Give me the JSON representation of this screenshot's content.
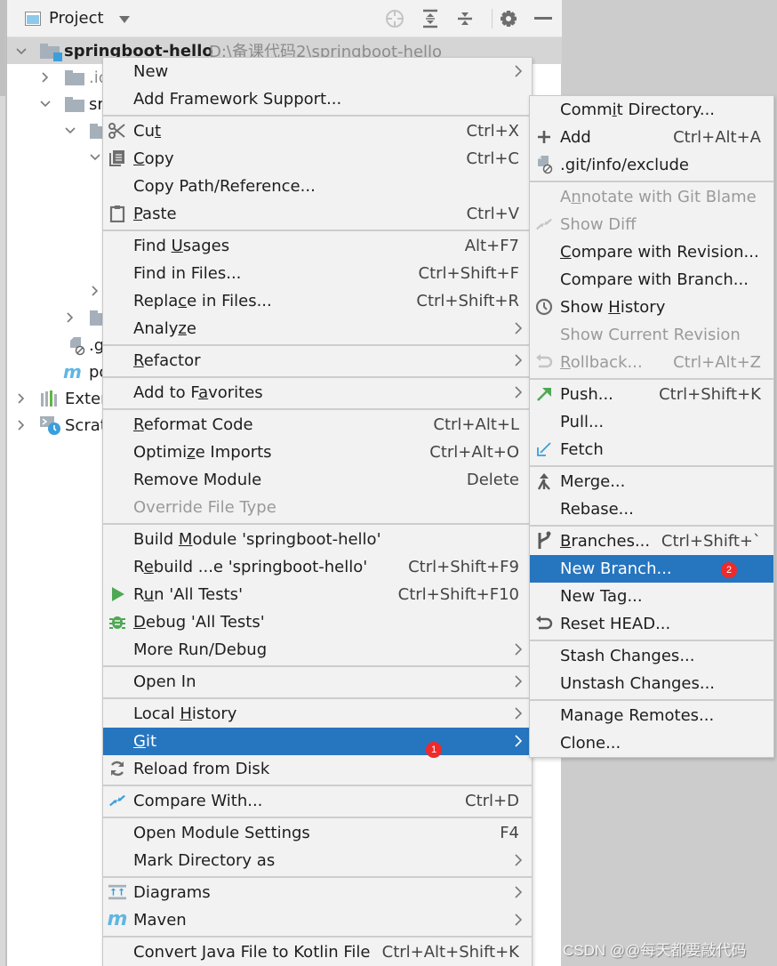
{
  "project_panel": {
    "title": "Project",
    "toolbar": [
      "locate-icon",
      "expand-all-icon",
      "collapse-all-icon",
      "gear-icon",
      "minimize-icon"
    ],
    "tree": [
      {
        "label": "springboot-hello",
        "path": "D:\\备课代码2\\springboot-hello",
        "expanded": true,
        "selected": true
      },
      {
        "label": ".idea",
        "visible": ".ic",
        "expanded": false
      },
      {
        "label": "src",
        "visible": "sr",
        "expanded": true
      },
      {
        "label": "",
        "expanded": true
      },
      {
        "label": "",
        "expanded": true
      },
      {
        "label": "",
        "expanded": false
      },
      {
        "label": "",
        "expanded": false
      },
      {
        "label": ".gitignore",
        "visible": ".g"
      },
      {
        "label": "pom.xml",
        "visible": "pc"
      },
      {
        "label": "External Libraries",
        "visible": "Exter",
        "expanded": false
      },
      {
        "label": "Scratches and Consoles",
        "visible": "Scrat",
        "expanded": false
      }
    ]
  },
  "context_menu": {
    "items": [
      {
        "label": "New",
        "submenu": true
      },
      {
        "label": "Add Framework Support..."
      },
      {
        "separator": true
      },
      {
        "label": "Cut",
        "shortcut": "Ctrl+X",
        "icon": "scissors-icon"
      },
      {
        "label": "Copy",
        "shortcut": "Ctrl+C",
        "icon": "copy-icon"
      },
      {
        "label": "Copy Path/Reference..."
      },
      {
        "label": "Paste",
        "shortcut": "Ctrl+V",
        "icon": "clipboard-icon"
      },
      {
        "separator": true
      },
      {
        "label": "Find Usages",
        "shortcut": "Alt+F7"
      },
      {
        "label": "Find in Files...",
        "shortcut": "Ctrl+Shift+F"
      },
      {
        "label": "Replace in Files...",
        "shortcut": "Ctrl+Shift+R"
      },
      {
        "label": "Analyze",
        "submenu": true
      },
      {
        "separator": true
      },
      {
        "label": "Refactor",
        "submenu": true
      },
      {
        "separator": true
      },
      {
        "label": "Add to Favorites",
        "submenu": true
      },
      {
        "separator": true
      },
      {
        "label": "Reformat Code",
        "shortcut": "Ctrl+Alt+L"
      },
      {
        "label": "Optimize Imports",
        "shortcut": "Ctrl+Alt+O"
      },
      {
        "label": "Remove Module",
        "shortcut": "Delete"
      },
      {
        "label": "Override File Type",
        "disabled": true
      },
      {
        "separator": true
      },
      {
        "label": "Build Module 'springboot-hello'"
      },
      {
        "label": "Rebuild ...e 'springboot-hello'",
        "shortcut": "Ctrl+Shift+F9"
      },
      {
        "label": "Run 'All Tests'",
        "shortcut": "Ctrl+Shift+F10",
        "icon": "run-icon"
      },
      {
        "label": "Debug 'All Tests'",
        "icon": "debug-icon"
      },
      {
        "label": "More Run/Debug",
        "submenu": true
      },
      {
        "separator": true
      },
      {
        "label": "Open In",
        "submenu": true
      },
      {
        "separator": true
      },
      {
        "label": "Local History",
        "submenu": true
      },
      {
        "label": "Git",
        "submenu": true,
        "highlighted": true,
        "badge": "1"
      },
      {
        "label": "Reload from Disk",
        "icon": "reload-icon"
      },
      {
        "separator": true
      },
      {
        "label": "Compare With...",
        "shortcut": "Ctrl+D",
        "icon": "compare-icon"
      },
      {
        "separator": true
      },
      {
        "label": "Open Module Settings",
        "shortcut": "F4"
      },
      {
        "label": "Mark Directory as",
        "submenu": true
      },
      {
        "separator": true
      },
      {
        "label": "Diagrams",
        "submenu": true,
        "icon": "diagram-icon"
      },
      {
        "label": "Maven",
        "submenu": true,
        "icon": "maven-icon"
      },
      {
        "separator": true
      },
      {
        "label": "Convert Java File to Kotlin File",
        "shortcut": "Ctrl+Alt+Shift+K"
      }
    ]
  },
  "git_submenu": {
    "items": [
      {
        "label": "Commit Directory..."
      },
      {
        "label": "Add",
        "shortcut": "Ctrl+Alt+A",
        "icon": "plus-icon"
      },
      {
        "label": ".git/info/exclude",
        "icon": "ignored-file-icon"
      },
      {
        "separator": true
      },
      {
        "label": "Annotate with Git Blame",
        "disabled": true
      },
      {
        "label": "Show Diff",
        "disabled": true,
        "icon": "diff-icon"
      },
      {
        "label": "Compare with Revision..."
      },
      {
        "label": "Compare with Branch..."
      },
      {
        "label": "Show History",
        "icon": "clock-icon"
      },
      {
        "label": "Show Current Revision",
        "disabled": true
      },
      {
        "label": "Rollback...",
        "shortcut": "Ctrl+Alt+Z",
        "disabled": true,
        "icon": "rollback-icon"
      },
      {
        "separator": true
      },
      {
        "label": "Push...",
        "shortcut": "Ctrl+Shift+K",
        "icon": "push-icon"
      },
      {
        "label": "Pull..."
      },
      {
        "label": "Fetch",
        "icon": "fetch-icon"
      },
      {
        "separator": true
      },
      {
        "label": "Merge...",
        "icon": "merge-icon"
      },
      {
        "label": "Rebase..."
      },
      {
        "separator": true
      },
      {
        "label": "Branches...",
        "shortcut": "Ctrl+Shift+`",
        "icon": "branch-icon"
      },
      {
        "label": "New Branch...",
        "highlighted": true,
        "badge": "2"
      },
      {
        "label": "New Tag..."
      },
      {
        "label": "Reset HEAD...",
        "icon": "reset-icon"
      },
      {
        "separator": true
      },
      {
        "label": "Stash Changes..."
      },
      {
        "label": "Unstash Changes..."
      },
      {
        "separator": true
      },
      {
        "label": "Manage Remotes..."
      },
      {
        "label": "Clone..."
      }
    ]
  },
  "watermark": "CSDN @@每天都要敲代码",
  "colors": {
    "highlight": "#2675bf",
    "badge": "#ee2a2a",
    "menu_bg": "#f2f2f2",
    "disabled_text": "#9a9a9a"
  }
}
